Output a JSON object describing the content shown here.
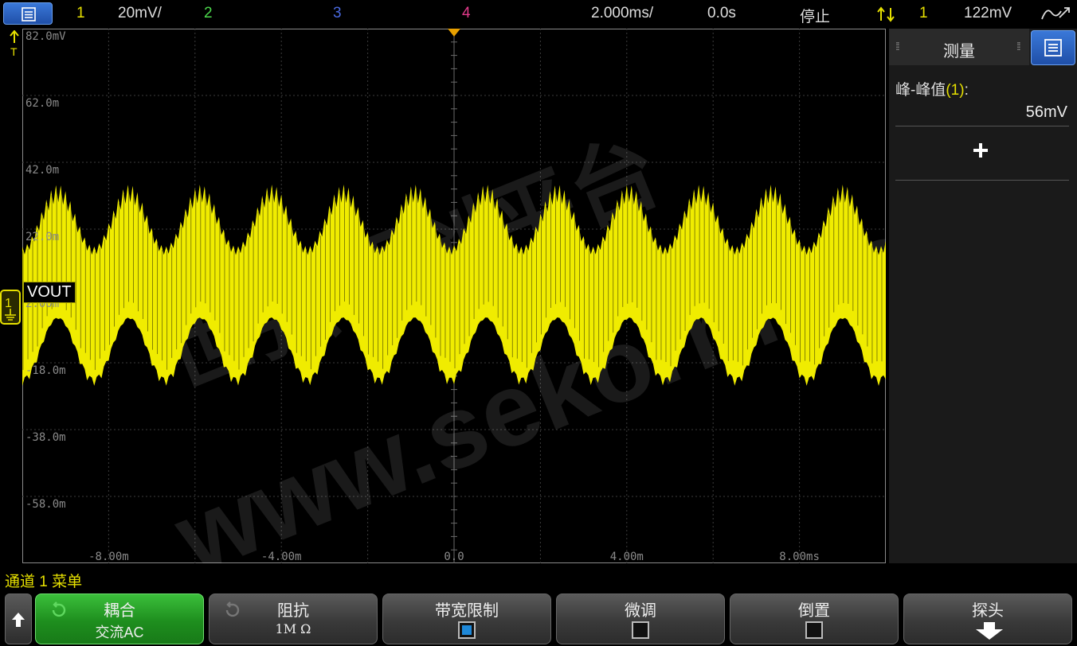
{
  "topbar": {
    "ch1_num": "1",
    "ch1_scale": "20mV/",
    "ch2_num": "2",
    "ch3_num": "3",
    "ch4_num": "4",
    "timebase": "2.000ms/",
    "delay": "0.0s",
    "run_state": "停止",
    "trigger_source": "1",
    "trigger_level": "122mV",
    "colors": {
      "ch1": "#e6e000",
      "ch2": "#4cd84c",
      "ch3": "#4a6ae0",
      "ch4": "#e03a8a"
    }
  },
  "scope": {
    "y_labels": [
      "82.0mV",
      "62.0m",
      "42.0m",
      "22.0m",
      "2.00m",
      "-18.0m",
      "-38.0m",
      "-58.0m"
    ],
    "x_labels": [
      "-8.00m",
      "-4.00m",
      "0.0",
      "4.00m",
      "8.00ms"
    ],
    "channel_label": "VOUT",
    "ground_marker": "1",
    "trigger_marker": "T"
  },
  "panel": {
    "title": "测量",
    "measurement_label": "峰-峰值",
    "measurement_channel": "(1)",
    "measurement_suffix": ":",
    "measurement_value": "56mV"
  },
  "bottom": {
    "menu_title": "通道 1 菜单",
    "softkeys": [
      {
        "line1": "耦合",
        "line2": "交流AC"
      },
      {
        "line1": "阻抗",
        "line2": "1M Ω"
      },
      {
        "line1": "带宽限制"
      },
      {
        "line1": "微调"
      },
      {
        "line1": "倒置"
      },
      {
        "line1": "探头"
      }
    ]
  }
}
